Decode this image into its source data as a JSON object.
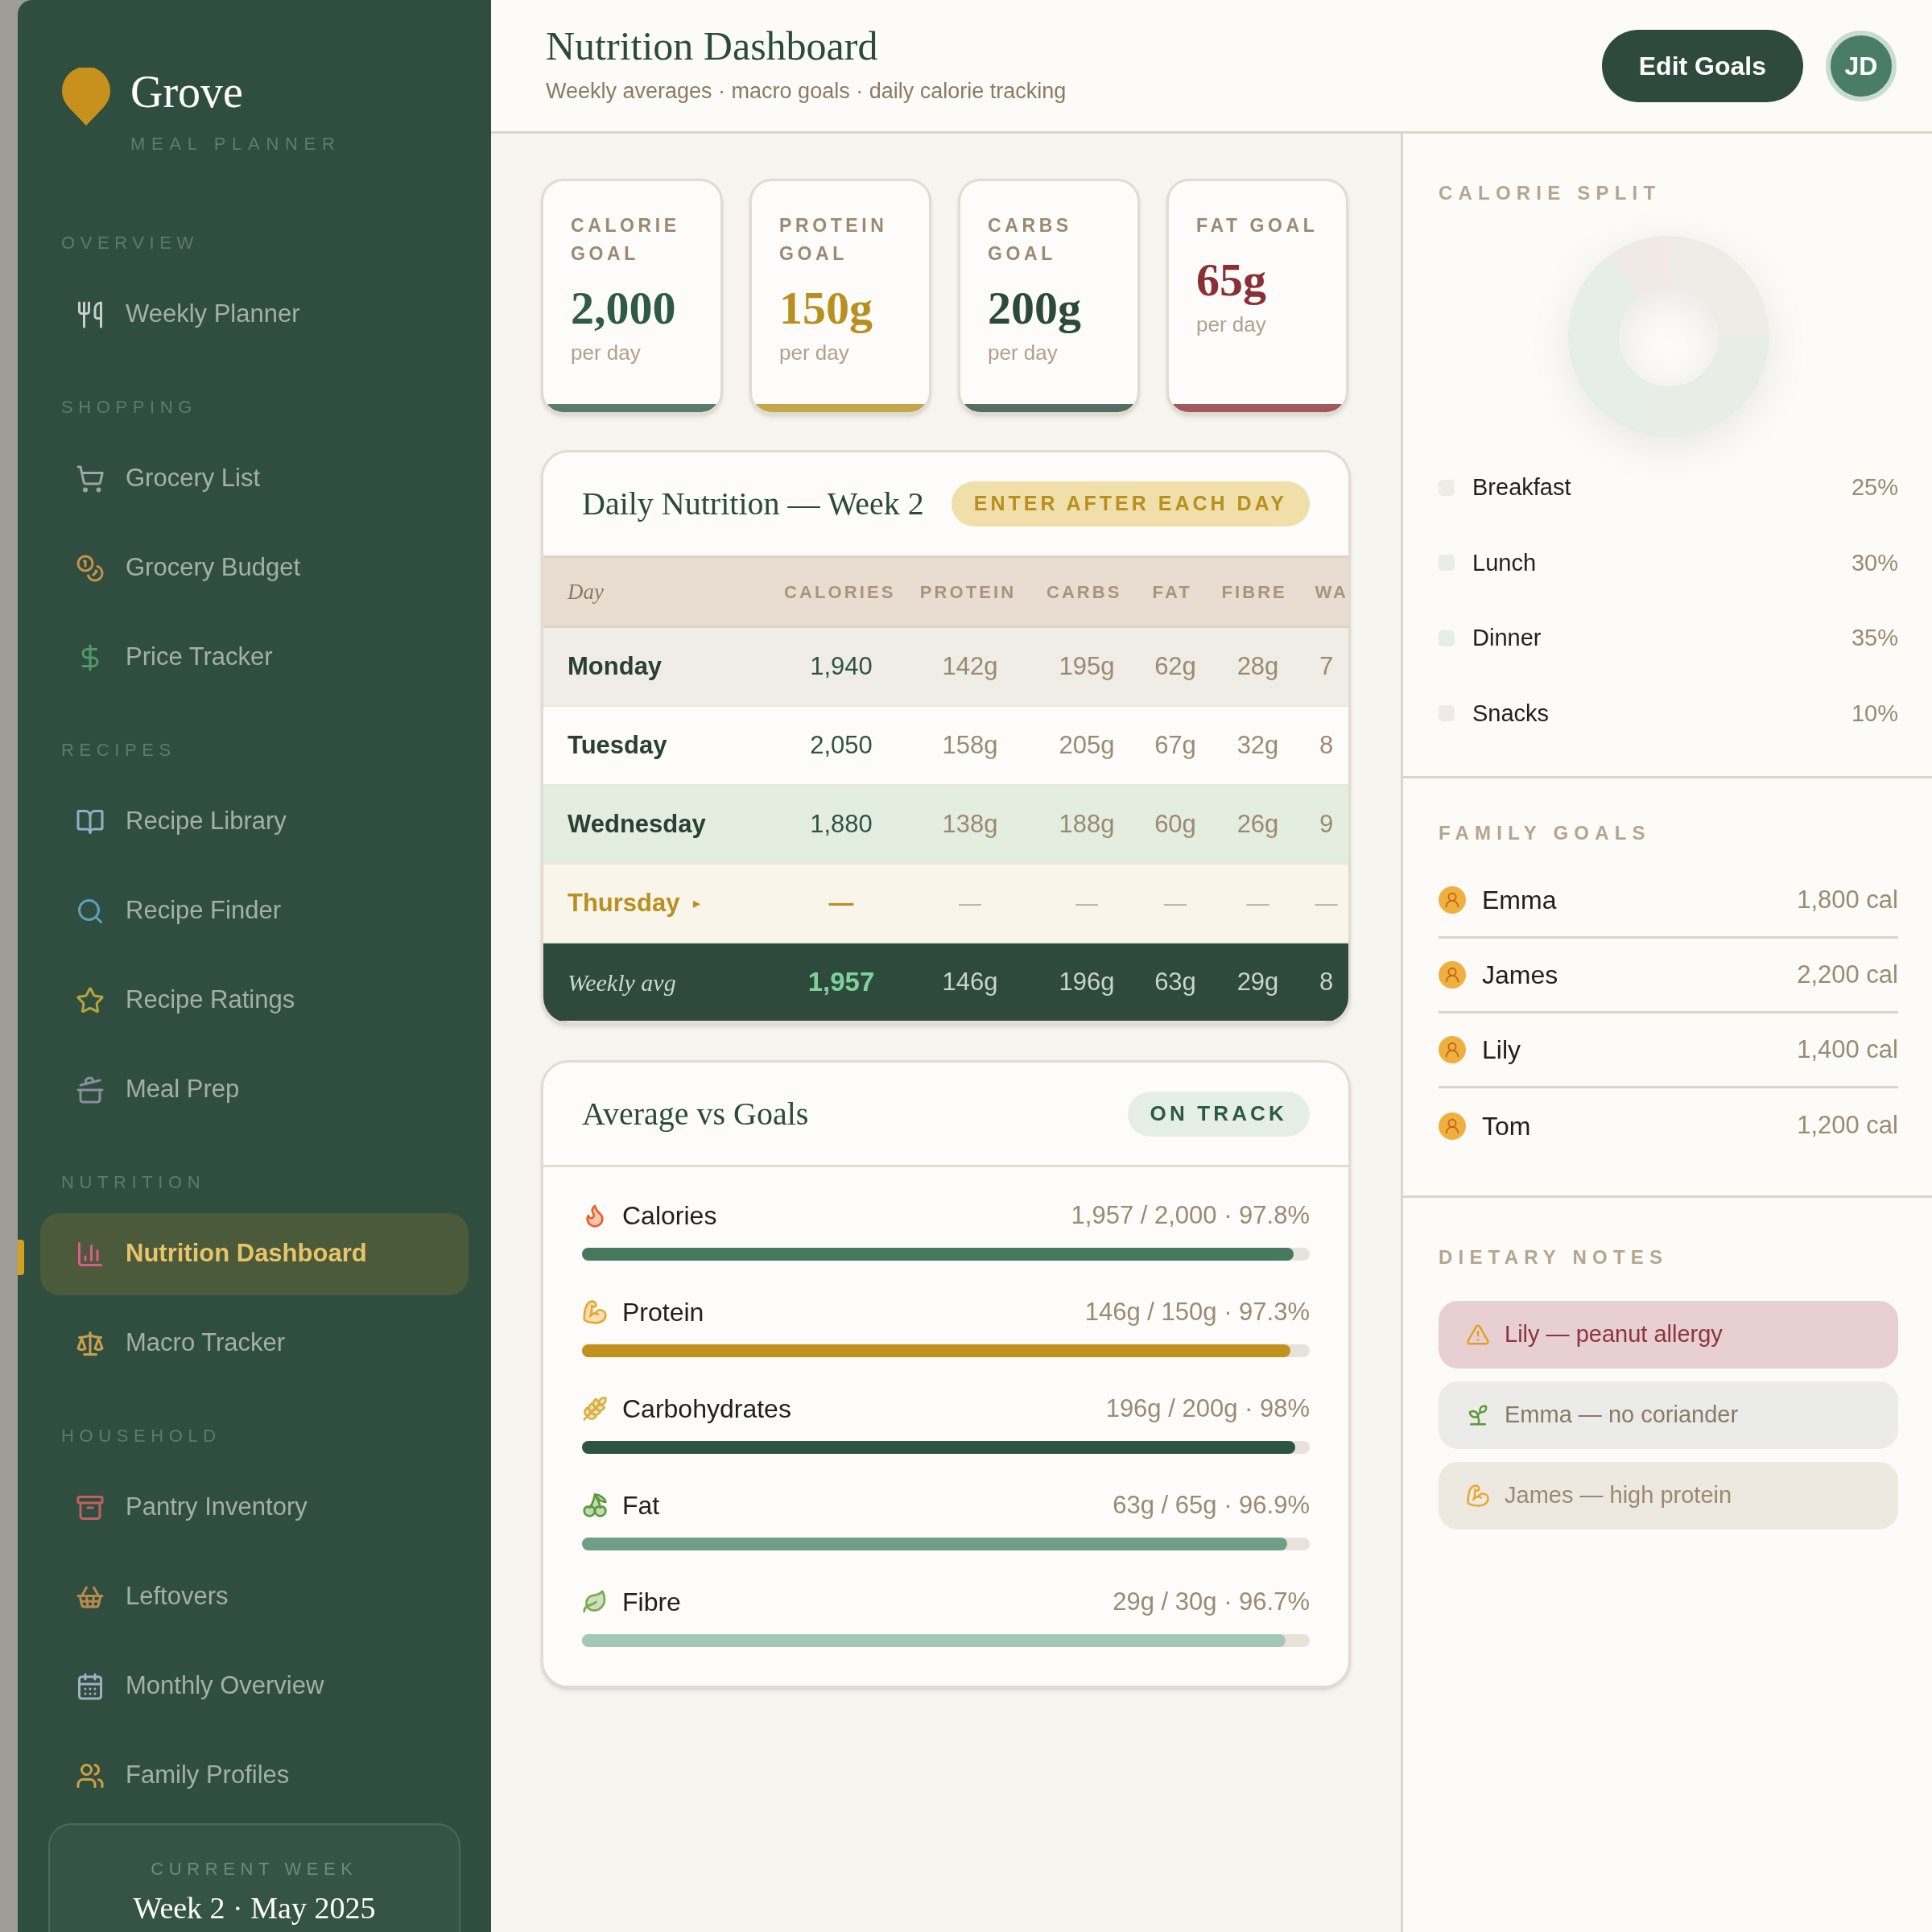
{
  "brand": {
    "name": "Grove",
    "tagline": "MEAL PLANNER"
  },
  "sidebar": {
    "sections": [
      {
        "label": "OVERVIEW",
        "items": [
          {
            "label": "Weekly Planner",
            "selected": false
          }
        ]
      },
      {
        "label": "SHOPPING",
        "items": [
          {
            "label": "Grocery List",
            "selected": false
          },
          {
            "label": "Grocery Budget",
            "selected": false
          },
          {
            "label": "Price Tracker",
            "selected": false
          }
        ]
      },
      {
        "label": "RECIPES",
        "items": [
          {
            "label": "Recipe Library",
            "selected": false
          },
          {
            "label": "Recipe Finder",
            "selected": false
          },
          {
            "label": "Recipe Ratings",
            "selected": false
          },
          {
            "label": "Meal Prep",
            "selected": false
          }
        ]
      },
      {
        "label": "NUTRITION",
        "items": [
          {
            "label": "Nutrition Dashboard",
            "selected": true
          },
          {
            "label": "Macro Tracker",
            "selected": false
          }
        ]
      },
      {
        "label": "HOUSEHOLD",
        "items": [
          {
            "label": "Pantry Inventory",
            "selected": false
          },
          {
            "label": "Leftovers",
            "selected": false
          },
          {
            "label": "Monthly Overview",
            "selected": false
          },
          {
            "label": "Family Profiles",
            "selected": false
          }
        ]
      }
    ],
    "current_week": {
      "label": "CURRENT WEEK",
      "value": "Week 2 · May 2025"
    }
  },
  "header": {
    "title": "Nutrition Dashboard",
    "subtitle": "Weekly averages · macro goals · daily calorie tracking",
    "button": "Edit Goals",
    "avatar": "JD"
  },
  "goals": [
    {
      "label": "CALORIE GOAL",
      "value": "2,000",
      "unit": "per day",
      "color": "#2f5a48"
    },
    {
      "label": "PROTEIN GOAL",
      "value": "150g",
      "unit": "per day",
      "color": "#b8901f"
    },
    {
      "label": "CARBS GOAL",
      "value": "200g",
      "unit": "per day",
      "color": "#2b4a3c"
    },
    {
      "label": "FAT GOAL",
      "value": "65g",
      "unit": "per day",
      "color": "#8a2f35"
    }
  ],
  "daily": {
    "title": "Daily Nutrition — Week 2",
    "badge": "ENTER AFTER EACH DAY",
    "columns": [
      "Day",
      "CALORIES",
      "PROTEIN",
      "CARBS",
      "FAT",
      "FIBRE",
      "WA"
    ],
    "rows": [
      {
        "kind": "day",
        "highlighted": false,
        "cells": [
          "Monday",
          "1,940",
          "142g",
          "195g",
          "62g",
          "28g",
          "7"
        ]
      },
      {
        "kind": "day",
        "highlighted": false,
        "cells": [
          "Tuesday",
          "2,050",
          "158g",
          "205g",
          "67g",
          "32g",
          "8"
        ]
      },
      {
        "kind": "day",
        "highlighted": true,
        "cells": [
          "Wednesday",
          "1,880",
          "138g",
          "188g",
          "60g",
          "26g",
          "9"
        ]
      },
      {
        "kind": "pending",
        "highlighted": false,
        "marker": "▸",
        "cells": [
          "Thursday",
          "—",
          "—",
          "—",
          "—",
          "—",
          "—"
        ]
      },
      {
        "kind": "average",
        "highlighted": false,
        "cells": [
          "Weekly avg",
          "1,957",
          "146g",
          "196g",
          "63g",
          "29g",
          "8"
        ]
      }
    ]
  },
  "averages": {
    "title": "Average vs Goals",
    "badge": "ON TRACK",
    "items": [
      {
        "label": "Calories",
        "reading": "1,957 / 2,000 · 97.8%",
        "level": 0.978,
        "color": "#46785f"
      },
      {
        "label": "Protein",
        "reading": "146g / 150g · 97.3%",
        "level": 0.973,
        "color": "#c2921f"
      },
      {
        "label": "Carbohydrates",
        "reading": "196g / 200g · 98%",
        "level": 0.98,
        "color": "#2f5443"
      },
      {
        "label": "Fat",
        "reading": "63g / 65g · 96.9%",
        "level": 0.969,
        "color": "#6f9e87"
      },
      {
        "label": "Fibre",
        "reading": "29g / 30g · 96.7%",
        "level": 0.967,
        "color": "#a5c7ba"
      }
    ]
  },
  "calorie_split": {
    "title": "CALORIE SPLIT",
    "legend": [
      {
        "label": "Breakfast",
        "value": "25%",
        "color": "#eeece4"
      },
      {
        "label": "Lunch",
        "value": "30%",
        "color": "#e8eee6"
      },
      {
        "label": "Dinner",
        "value": "35%",
        "color": "#e5eee9"
      },
      {
        "label": "Snacks",
        "value": "10%",
        "color": "#f0e9e5"
      }
    ]
  },
  "family_goals": {
    "title": "FAMILY GOALS",
    "members": [
      {
        "name": "Emma",
        "goal": "1,800 cal"
      },
      {
        "name": "James",
        "goal": "2,200 cal"
      },
      {
        "name": "Lily",
        "goal": "1,400 cal"
      },
      {
        "name": "Tom",
        "goal": "1,200 cal"
      }
    ]
  },
  "dietary_notes": {
    "title": "DIETARY NOTES",
    "notes": [
      {
        "kind": "allergy",
        "text": "Lily — peanut allergy"
      },
      {
        "kind": "preference",
        "text": "Emma — no coriander"
      },
      {
        "kind": "goal",
        "text": "James — high protein"
      }
    ]
  }
}
